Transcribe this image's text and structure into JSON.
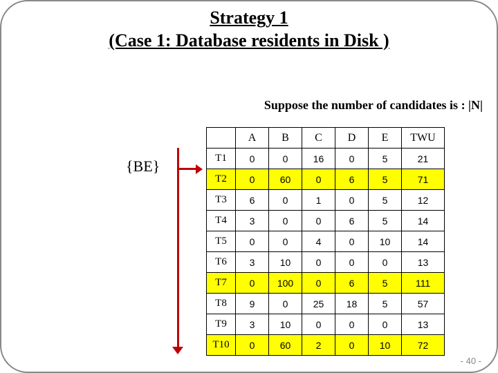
{
  "title_line1": "Strategy 1",
  "title_line2": "(Case 1: Database residents in Disk )",
  "suppose_text": "Suppose the number of candidates is : |N|",
  "be_label": "{BE}",
  "page_number": "- 40 -",
  "chart_data": {
    "type": "table",
    "columns": [
      "A",
      "B",
      "C",
      "D",
      "E",
      "TWU"
    ],
    "rows": [
      "T1",
      "T2",
      "T3",
      "T4",
      "T5",
      "T6",
      "T7",
      "T8",
      "T9",
      "T10"
    ],
    "data": [
      [
        0,
        0,
        16,
        0,
        5,
        21
      ],
      [
        0,
        60,
        0,
        6,
        5,
        71
      ],
      [
        6,
        0,
        1,
        0,
        5,
        12
      ],
      [
        3,
        0,
        0,
        6,
        5,
        14
      ],
      [
        0,
        0,
        4,
        0,
        10,
        14
      ],
      [
        3,
        10,
        0,
        0,
        0,
        13
      ],
      [
        0,
        100,
        0,
        6,
        5,
        111
      ],
      [
        9,
        0,
        25,
        18,
        5,
        57
      ],
      [
        3,
        10,
        0,
        0,
        0,
        13
      ],
      [
        0,
        60,
        2,
        0,
        10,
        72
      ]
    ],
    "highlighted_rows": [
      1,
      6,
      9
    ]
  }
}
